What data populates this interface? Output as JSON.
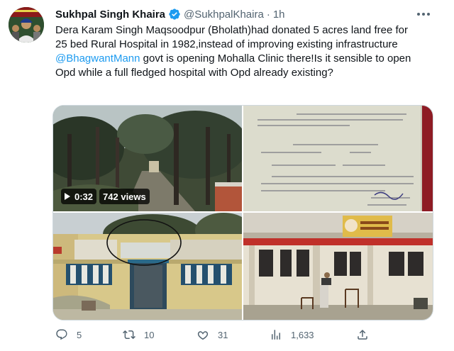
{
  "author": {
    "name": "Sukhpal Singh Khaira",
    "handle": "@SukhpalKhaira",
    "separator": "·",
    "time": "1h"
  },
  "tweet": {
    "text_part1": "Dera Karam Singh Maqsoodpur (Bholath)had donated 5 acres land free for 25 bed Rural Hospital in 1982,instead of improving existing infrastructure ",
    "mention": "@BhagwantMann",
    "text_part2": " govt is opening Mohalla Clinic there!Is it sensible to open Opd while a full fledged hospital with Opd already existing?"
  },
  "video": {
    "duration": "0:32",
    "views": "742 views"
  },
  "actions": {
    "replies": "5",
    "retweets": "10",
    "likes": "31",
    "views": "1,633"
  },
  "icons": [
    "verified-badge-icon",
    "more-icon",
    "play-icon",
    "reply-icon",
    "retweet-icon",
    "like-icon",
    "views-icon",
    "share-icon"
  ],
  "colors": {
    "accent": "#1d9bf0",
    "muted": "#536471",
    "text": "#0f1419"
  }
}
